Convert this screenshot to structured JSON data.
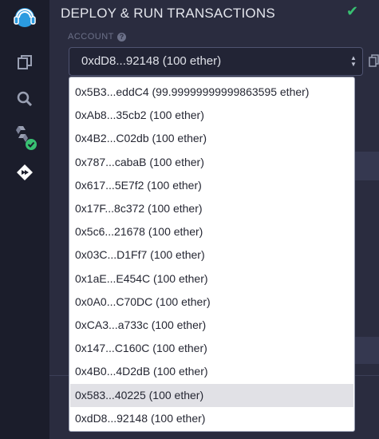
{
  "panel": {
    "title": "DEPLOY & RUN TRANSACTIONS",
    "account_label": "ACCOUNT",
    "selected_account": "0xdD8...92148 (100 ether)"
  },
  "rail": {
    "items": [
      {
        "name": "remix-logo-icon"
      },
      {
        "name": "file-explorer-icon"
      },
      {
        "name": "search-icon"
      },
      {
        "name": "solidity-compiler-icon"
      },
      {
        "name": "deploy-run-icon"
      }
    ]
  },
  "dropdown": {
    "options": [
      "0x5B3...eddC4 (99.99999999999863595 ether)",
      "0xAb8...35cb2 (100 ether)",
      "0x4B2...C02db (100 ether)",
      "0x787...cabaB (100 ether)",
      "0x617...5E7f2 (100 ether)",
      "0x17F...8c372 (100 ether)",
      "0x5c6...21678 (100 ether)",
      "0x03C...D1Ff7 (100 ether)",
      "0x1aE...E454C (100 ether)",
      "0x0A0...C70DC (100 ether)",
      "0xCA3...a733c (100 ether)",
      "0x147...C160C (100 ether)",
      "0x4B0...4D2dB (100 ether)",
      "0x583...40225 (100 ether)",
      "0xdD8...92148 (100 ether)"
    ],
    "highlighted_index": 13
  },
  "colors": {
    "accent": "#38c172",
    "panel": "#2a2c3f",
    "rail": "#1b1d2b"
  }
}
